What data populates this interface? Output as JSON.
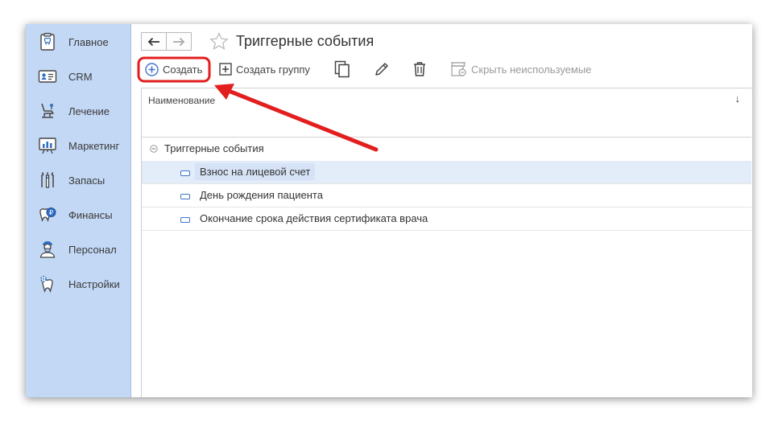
{
  "sidebar": {
    "items": [
      {
        "label": "Главное",
        "icon": "tooth-clipboard-icon"
      },
      {
        "label": "CRM",
        "icon": "id-card-icon"
      },
      {
        "label": "Лечение",
        "icon": "dental-chair-icon"
      },
      {
        "label": "Маркетинг",
        "icon": "presentation-board-icon"
      },
      {
        "label": "Запасы",
        "icon": "dental-tools-icon"
      },
      {
        "label": "Финансы",
        "icon": "tooth-coin-icon"
      },
      {
        "label": "Персонал",
        "icon": "doctor-icon"
      },
      {
        "label": "Настройки",
        "icon": "tooth-gear-icon"
      }
    ]
  },
  "header": {
    "title": "Триггерные события",
    "back_icon": "arrow-left-icon",
    "forward_icon": "arrow-right-icon",
    "favorite_icon": "star-icon"
  },
  "toolbar": {
    "create_label": "Создать",
    "create_group_label": "Создать группу",
    "hide_unused_label": "Скрыть неиспользуемые",
    "copy_icon": "copy-icon",
    "edit_icon": "pencil-icon",
    "delete_icon": "trash-icon"
  },
  "list": {
    "column_header": "Наименование",
    "sort_indicator": "↓",
    "group": {
      "label": "Триггерные события",
      "icon": "collapse-minus-icon"
    },
    "items": [
      {
        "label": "Взнос на лицевой счет",
        "selected": true
      },
      {
        "label": "День рождения пациента",
        "selected": false
      },
      {
        "label": "Окончание срока действия сертификата врача",
        "selected": false
      }
    ]
  },
  "annotation": {
    "color": "#e31e1e"
  },
  "colors": {
    "sidebar_bg": "#c3d8f5",
    "accent": "#3e74c7",
    "selected_row": "#e3ecf9"
  }
}
